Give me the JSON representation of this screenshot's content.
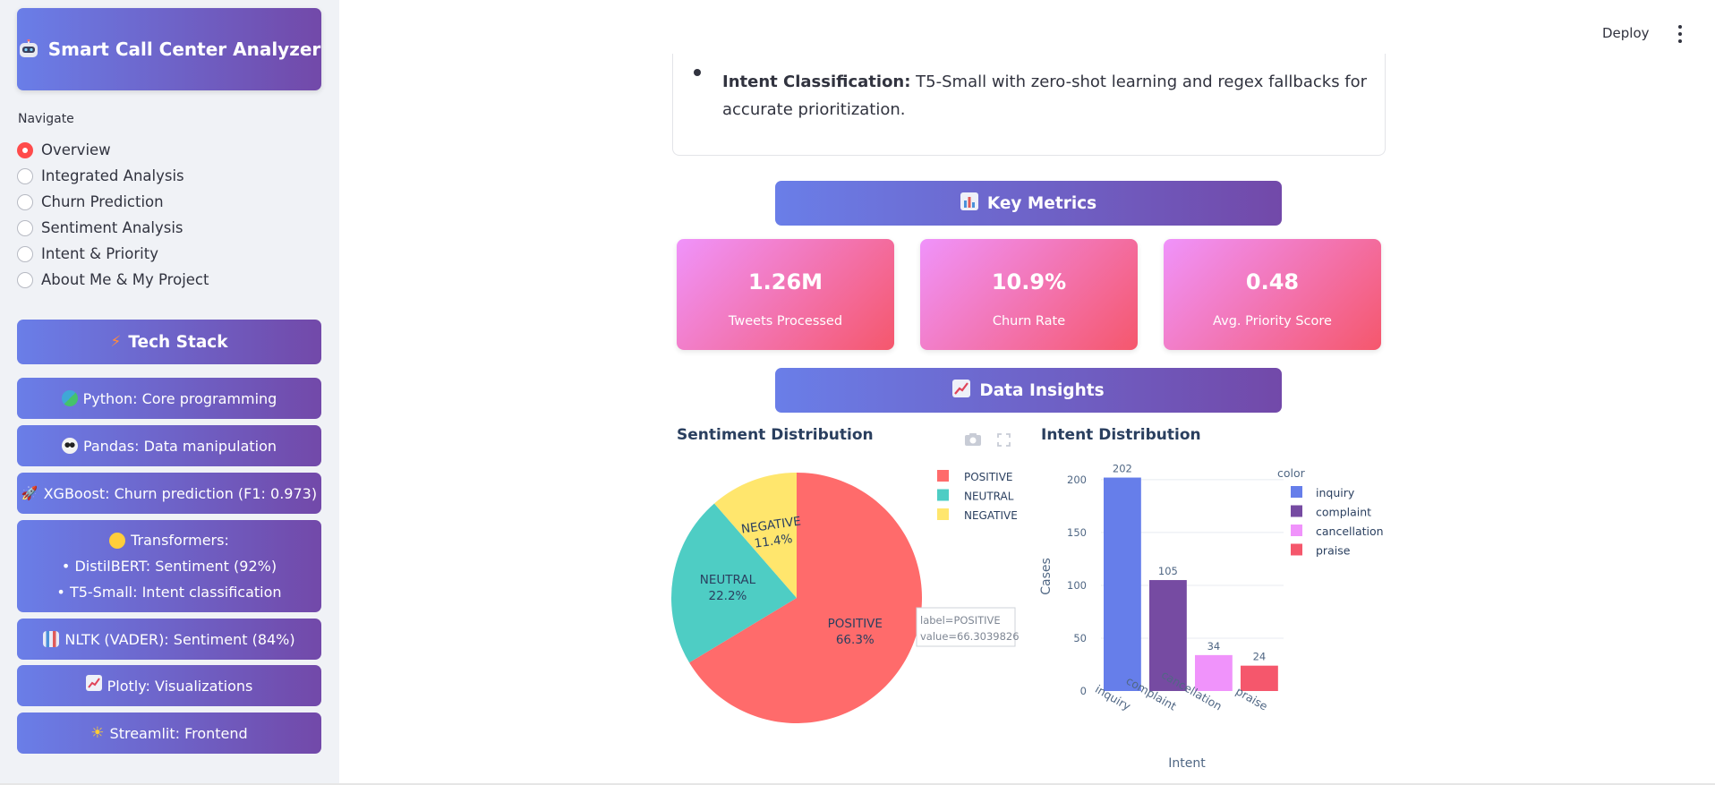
{
  "sidebar": {
    "app_title": "Smart Call Center Analyzer",
    "nav_label": "Navigate",
    "nav_items": [
      {
        "label": "Overview",
        "selected": true
      },
      {
        "label": "Integrated Analysis",
        "selected": false
      },
      {
        "label": "Churn Prediction",
        "selected": false
      },
      {
        "label": "Sentiment Analysis",
        "selected": false
      },
      {
        "label": "Intent & Priority",
        "selected": false
      },
      {
        "label": "About Me & My Project",
        "selected": false
      }
    ],
    "tech_stack_title": "Tech Stack",
    "tech_items": {
      "python": "Python: Core programming",
      "pandas": "Pandas: Data manipulation",
      "xgboost": "XGBoost: Churn prediction (F1: 0.973)",
      "transformers_title": "Transformers:",
      "transformers_line1": "• DistilBERT: Sentiment (92%)",
      "transformers_line2": "• T5-Small: Intent classification",
      "nltk": "NLTK (VADER): Sentiment (84%)",
      "plotly": "Plotly: Visualizations",
      "streamlit": "Streamlit: Frontend"
    }
  },
  "topbar": {
    "deploy_label": "Deploy"
  },
  "intent_card": {
    "bold": "Intent Classification:",
    "text": " T5-Small with zero-shot learning and regex fallbacks for accurate prioritization."
  },
  "key_metrics": {
    "title": "Key Metrics",
    "items": [
      {
        "value": "1.26M",
        "label": "Tweets Processed"
      },
      {
        "value": "10.9%",
        "label": "Churn Rate"
      },
      {
        "value": "0.48",
        "label": "Avg. Priority Score"
      }
    ]
  },
  "data_insights": {
    "title": "Data Insights"
  },
  "colors": {
    "positive": "#ff6b6b",
    "neutral": "#4ecdc4",
    "negative": "#ffe66d",
    "inquiry": "#667eea",
    "complaint": "#764ba2",
    "cancellation": "#f093fb",
    "praise": "#f5576c"
  },
  "chart_data": [
    {
      "type": "pie",
      "title": "Sentiment Distribution",
      "labels": [
        "POSITIVE",
        "NEUTRAL",
        "NEGATIVE"
      ],
      "values": [
        66.3039826,
        22.2,
        11.4
      ],
      "display": [
        "66.3%",
        "22.2%",
        "11.4%"
      ],
      "legend": "top-right",
      "hover": {
        "line1": "label=POSITIVE",
        "line2": "value=66.3039826"
      }
    },
    {
      "type": "bar",
      "title": "Intent Distribution",
      "categories": [
        "inquiry",
        "complaint",
        "cancellation",
        "praise"
      ],
      "values": [
        202,
        105,
        34,
        24
      ],
      "xlabel": "Intent",
      "ylabel": "Cases",
      "yticks": [
        0,
        50,
        100,
        150,
        200
      ],
      "ylim": [
        0,
        205
      ],
      "legend_title": "color",
      "legend": "top-right",
      "grid": true
    }
  ]
}
